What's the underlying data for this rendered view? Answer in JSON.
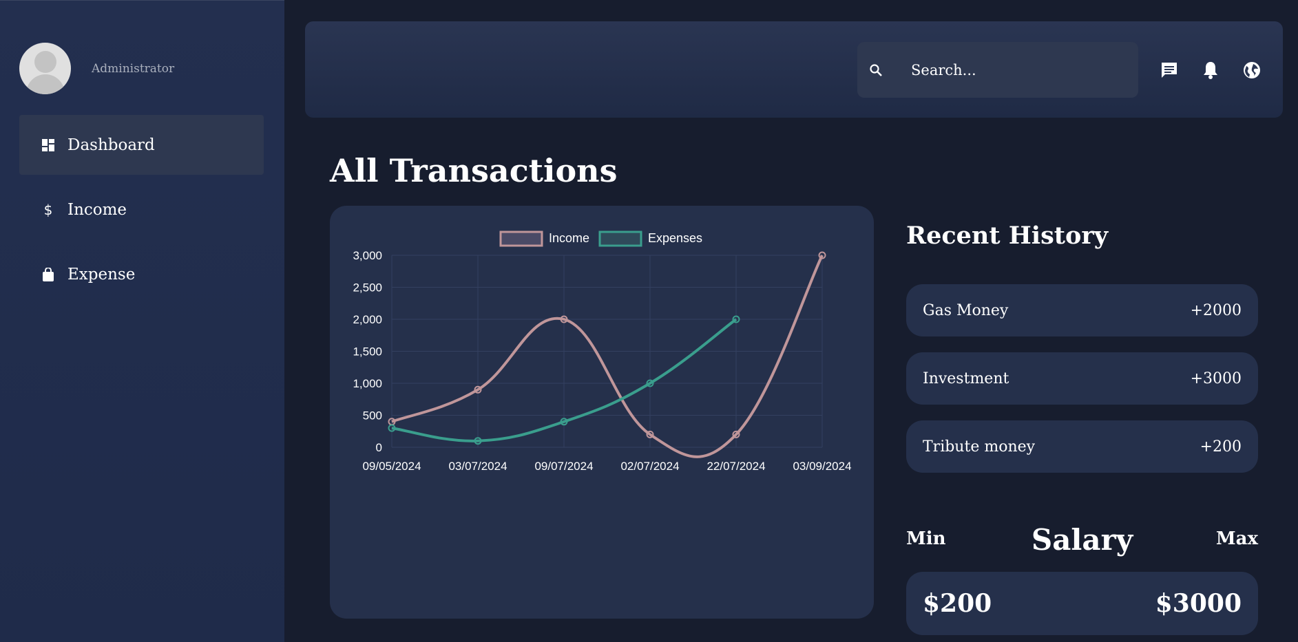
{
  "sidebar": {
    "role": "Administrator",
    "items": [
      {
        "label": "Dashboard",
        "icon": "dashboard-icon",
        "active": true
      },
      {
        "label": "Income",
        "icon": "dollar-icon",
        "active": false
      },
      {
        "label": "Expense",
        "icon": "shopping-bag-icon",
        "active": false
      }
    ]
  },
  "topbar": {
    "search_placeholder": "Search...",
    "icons": [
      "search-icon",
      "message-icon",
      "bell-icon",
      "globe-icon"
    ]
  },
  "main": {
    "title": "All Transactions"
  },
  "chart_data": {
    "type": "line",
    "categories": [
      "09/05/2024",
      "03/07/2024",
      "09/07/2024",
      "02/07/2024",
      "22/07/2024",
      "03/09/2024"
    ],
    "series": [
      {
        "name": "Income",
        "values": [
          400,
          900,
          2000,
          200,
          200,
          3000
        ],
        "color": "#c0969a"
      },
      {
        "name": "Expenses",
        "values": [
          300,
          100,
          400,
          1000,
          2000,
          null
        ],
        "color": "#3a9e8d"
      }
    ],
    "yticks": [
      "0",
      "500",
      "1,000",
      "1,500",
      "2,000",
      "2,500",
      "3,000"
    ],
    "ylim": [
      0,
      3000
    ],
    "grid": true,
    "legend": "top"
  },
  "recent_history": {
    "title": "Recent History",
    "items": [
      {
        "name": "Gas Money",
        "amount": "+2000"
      },
      {
        "name": "Investment",
        "amount": "+3000"
      },
      {
        "name": "Tribute money",
        "amount": "+200"
      }
    ]
  },
  "salary": {
    "title": "Salary",
    "min_label": "Min",
    "max_label": "Max",
    "min_value": "$200",
    "max_value": "$3000"
  },
  "colors": {
    "background": "#171d2e",
    "sidebar": "#232f4f",
    "card": "#25304b",
    "active_item": "#2e3850"
  }
}
